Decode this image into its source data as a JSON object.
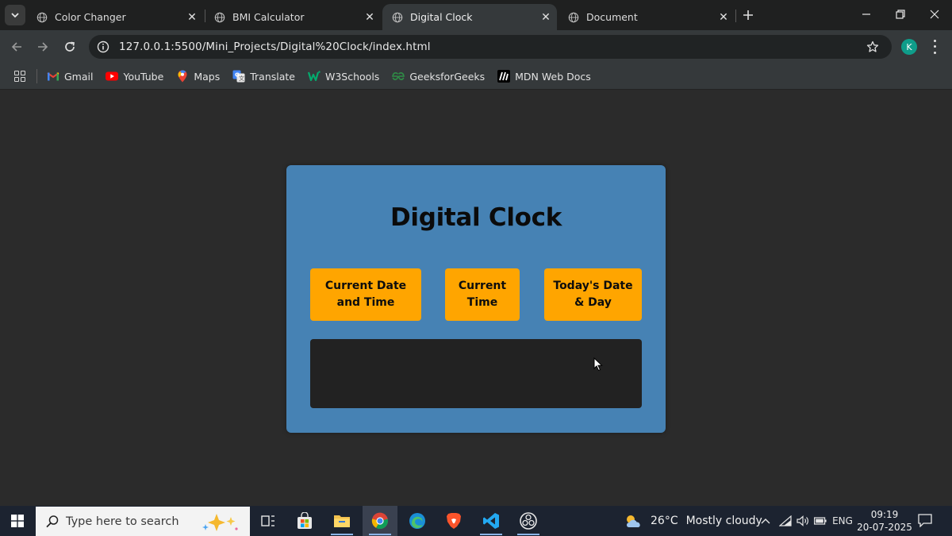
{
  "browser": {
    "tabs": [
      {
        "title": "Color Changer",
        "active": false
      },
      {
        "title": "BMI Calculator",
        "active": false
      },
      {
        "title": "Digital Clock",
        "active": true
      },
      {
        "title": "Document",
        "active": false
      }
    ],
    "url": "127.0.0.1:5500/Mini_Projects/Digital%20Clock/index.html",
    "profile_initial": "K",
    "bookmarks": [
      {
        "label": "Gmail",
        "icon": "gmail-icon"
      },
      {
        "label": "YouTube",
        "icon": "youtube-icon"
      },
      {
        "label": "Maps",
        "icon": "maps-icon"
      },
      {
        "label": "Translate",
        "icon": "translate-icon"
      },
      {
        "label": "W3Schools",
        "icon": "w3schools-icon"
      },
      {
        "label": "GeeksforGeeks",
        "icon": "geeksforgeeks-icon"
      },
      {
        "label": "MDN Web Docs",
        "icon": "mdn-icon"
      }
    ]
  },
  "page": {
    "title": "Digital Clock",
    "buttons": {
      "datetime": "Current Date and Time",
      "time": "Current Time",
      "date_day": "Today's Date & Day"
    },
    "display_text": ""
  },
  "taskbar": {
    "search_placeholder": "Type here to search",
    "weather": {
      "temp": "26°C",
      "condition": "Mostly cloudy"
    },
    "language": "ENG",
    "time": "09:19",
    "date": "20-07-2025"
  },
  "colors": {
    "page_bg": "#2b2b2b",
    "card_bg": "#4682b4",
    "button_bg": "#ffa500",
    "display_bg": "#222222"
  }
}
